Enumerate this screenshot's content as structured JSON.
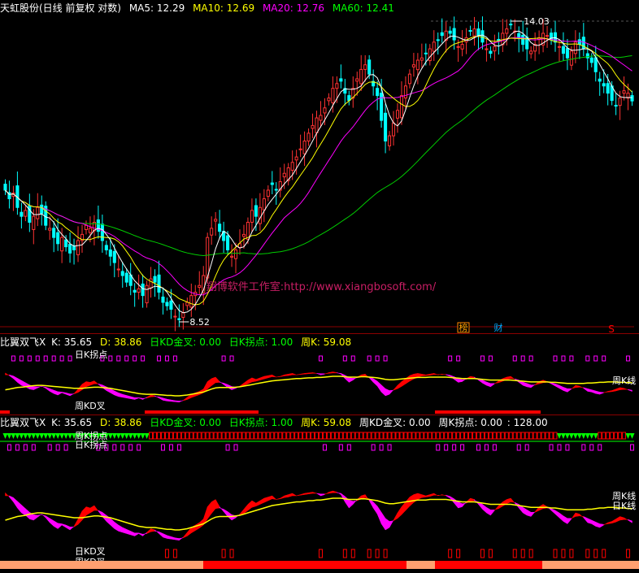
{
  "header_main": {
    "title": "天虹股份(日线 前复权 对数)",
    "ma5": "MA5: 12.29",
    "ma10": "MA10: 12.69",
    "ma20": "MA20: 12.76",
    "ma60": "MA60: 12.41"
  },
  "header_ind1": {
    "name": "比翼双飞X",
    "k": "K: 35.65",
    "d": "D: 38.86",
    "kd_cross": "日KD金叉: 0.00",
    "k_turn": "日K拐点: 1.00",
    "wk": "周K: 59.08"
  },
  "header_ind2": {
    "name": "比翼双飞X",
    "k": "K: 35.65",
    "d": "D: 38.86",
    "kd_cross": "日KD金叉: 0.00",
    "k_turn": "日K拐点: 1.00",
    "wk": "周K: 59.08",
    "wk_cross": "周KD金叉: 0.00",
    "wk_turn": "周K拐点: 0.00",
    "wk_extra": ": 128.00"
  },
  "price_labels": {
    "high": "14.03",
    "low": "8.52"
  },
  "watermark": "翔博软件工作室:http://www.xiangbosoft.com/",
  "badges": {
    "bang": "榜",
    "cai": "财",
    "s": "S"
  },
  "ind1_labels": {
    "top": "日K拐点",
    "bottom": "周KD叉",
    "right": "周K线"
  },
  "ind2_labels": {
    "top1": "周K拐点",
    "top2": "日K拐点",
    "bot1": "日KD叉",
    "bot2": "周KD叉",
    "right1": "周K线",
    "right2": "日K线"
  },
  "colors": {
    "up": "#ff3232",
    "down": "#00ffff",
    "ma5": "#ffffff",
    "ma10": "#ffff00",
    "ma20": "#ff00ff",
    "ma60": "#00cc00",
    "accent_red": "#ff0000",
    "magenta": "#ff00ff",
    "yellow": "#ffff00",
    "green_arrow": "#00ff00",
    "salmon": "#ffa070",
    "frame": "#8b0000"
  },
  "chart_data": {
    "type": "candlestick",
    "scale": "log",
    "price_range": [
      8.52,
      14.03
    ],
    "x": [
      0,
      1,
      2,
      3,
      4,
      5,
      6,
      7,
      8,
      9,
      10,
      11,
      12,
      13,
      14,
      15,
      16,
      17,
      18,
      19,
      20,
      21,
      22,
      23,
      24,
      25,
      26,
      27,
      28,
      29,
      30,
      31,
      32,
      33,
      34,
      35,
      36,
      37,
      38,
      39,
      40,
      41,
      42,
      43,
      44,
      45,
      46,
      47,
      48,
      49,
      50,
      51,
      52,
      53,
      54,
      55,
      56,
      57,
      58,
      59,
      60,
      61,
      62,
      63,
      64,
      65,
      66,
      67,
      68,
      69,
      70,
      71,
      72,
      73,
      74,
      75,
      76,
      77,
      78,
      79,
      80,
      81,
      82,
      83,
      84,
      85,
      86,
      87,
      88,
      89,
      90,
      91,
      92,
      93,
      94,
      95,
      96,
      97,
      98,
      99,
      100,
      101,
      102,
      103,
      104,
      105,
      106,
      107,
      108,
      109,
      110,
      111,
      112,
      113,
      114,
      115,
      116,
      117,
      118,
      119,
      120,
      121,
      122,
      123,
      124,
      125,
      126,
      127,
      128,
      129,
      130,
      131,
      132,
      133,
      134,
      135,
      136,
      137,
      138,
      139,
      140,
      141,
      142,
      143,
      144,
      145,
      146,
      147,
      148,
      149,
      150,
      151,
      152,
      153,
      154,
      155
    ],
    "close": [
      10.6,
      10.45,
      10.55,
      10.3,
      10.15,
      10.25,
      10.05,
      10.15,
      10.3,
      10.2,
      10.0,
      9.95,
      9.8,
      9.7,
      9.8,
      9.65,
      9.55,
      9.6,
      9.75,
      9.85,
      10.0,
      9.95,
      10.05,
      9.9,
      9.75,
      9.6,
      9.5,
      9.4,
      9.3,
      9.2,
      9.1,
      9.05,
      8.95,
      9.0,
      8.9,
      9.05,
      9.15,
      9.1,
      8.95,
      8.8,
      8.75,
      8.7,
      8.6,
      8.55,
      8.65,
      8.8,
      8.9,
      8.95,
      9.05,
      9.2,
      9.8,
      9.95,
      10.1,
      9.9,
      9.75,
      9.6,
      9.5,
      9.6,
      9.7,
      9.85,
      10.05,
      10.25,
      10.15,
      10.3,
      10.45,
      10.6,
      10.7,
      10.6,
      10.75,
      10.9,
      11.0,
      11.1,
      11.2,
      11.35,
      11.5,
      11.65,
      11.8,
      11.95,
      12.0,
      12.15,
      12.35,
      12.55,
      12.65,
      12.7,
      12.45,
      12.3,
      12.55,
      12.75,
      12.95,
      13.05,
      12.85,
      12.6,
      12.4,
      11.9,
      11.5,
      11.6,
      11.85,
      12.1,
      12.4,
      12.6,
      12.85,
      13.05,
      13.15,
      13.2,
      13.3,
      13.4,
      13.55,
      13.6,
      13.7,
      13.8,
      13.75,
      13.6,
      13.45,
      13.5,
      13.65,
      13.8,
      13.85,
      13.7,
      13.55,
      13.4,
      13.3,
      13.45,
      13.6,
      13.75,
      13.85,
      13.95,
      13.8,
      13.65,
      13.5,
      13.4,
      13.35,
      13.5,
      13.65,
      13.75,
      13.7,
      13.6,
      13.55,
      13.45,
      13.3,
      13.2,
      13.35,
      13.55,
      13.5,
      13.4,
      13.2,
      13.1,
      12.9,
      12.7,
      12.6,
      12.45,
      12.3,
      12.2,
      12.35,
      12.5,
      12.45,
      12.29
    ],
    "k_daily": [
      85,
      78,
      70,
      60,
      52,
      48,
      42,
      40,
      45,
      50,
      44,
      36,
      30,
      26,
      32,
      28,
      24,
      30,
      42,
      55,
      62,
      60,
      64,
      55,
      46,
      38,
      32,
      26,
      22,
      20,
      18,
      16,
      14,
      18,
      14,
      20,
      26,
      24,
      18,
      12,
      10,
      9,
      8,
      7,
      12,
      20,
      28,
      32,
      36,
      42,
      62,
      70,
      74,
      62,
      54,
      46,
      40,
      44,
      50,
      58,
      66,
      72,
      68,
      72,
      76,
      78,
      80,
      74,
      76,
      80,
      82,
      84,
      80,
      82,
      84,
      85,
      86,
      84,
      80,
      82,
      86,
      88,
      86,
      82,
      70,
      60,
      66,
      74,
      80,
      82,
      72,
      60,
      50,
      34,
      24,
      28,
      40,
      52,
      62,
      70,
      78,
      82,
      84,
      82,
      80,
      82,
      84,
      80,
      82,
      80,
      76,
      68,
      60,
      62,
      70,
      76,
      74,
      66,
      58,
      52,
      48,
      56,
      64,
      70,
      74,
      76,
      68,
      60,
      52,
      48,
      46,
      54,
      62,
      66,
      62,
      56,
      50,
      44,
      38,
      34,
      42,
      52,
      50,
      44,
      36,
      34,
      30,
      28,
      32,
      36,
      38,
      42,
      46,
      44,
      40,
      35.65
    ],
    "d_daily": [
      80,
      80,
      77,
      71,
      65,
      59,
      53,
      49,
      48,
      49,
      47,
      43,
      39,
      35,
      34,
      32,
      29,
      29,
      33,
      40,
      48,
      52,
      56,
      56,
      53,
      48,
      43,
      37,
      32,
      28,
      25,
      22,
      19,
      19,
      17,
      18,
      21,
      22,
      21,
      18,
      15,
      13,
      11,
      10,
      11,
      14,
      19,
      23,
      27,
      32,
      42,
      51,
      59,
      60,
      58,
      54,
      49,
      47,
      48,
      51,
      56,
      61,
      63,
      66,
      69,
      72,
      75,
      74,
      75,
      77,
      78,
      80,
      80,
      81,
      82,
      83,
      84,
      84,
      83,
      83,
      84,
      85,
      85,
      84,
      79,
      73,
      71,
      72,
      75,
      77,
      75,
      70,
      63,
      53,
      43,
      38,
      39,
      43,
      49,
      56,
      63,
      69,
      74,
      77,
      78,
      79,
      81,
      81,
      81,
      81,
      79,
      75,
      70,
      67,
      68,
      71,
      72,
      70,
      66,
      61,
      57,
      57,
      59,
      63,
      67,
      70,
      69,
      66,
      61,
      57,
      53,
      53,
      56,
      59,
      60,
      59,
      56,
      52,
      47,
      43,
      43,
      46,
      47,
      46,
      43,
      40,
      37,
      34,
      33,
      34,
      35,
      37,
      40,
      41,
      41,
      38.86
    ],
    "k_weekly": [
      40,
      42,
      44,
      46,
      47,
      48,
      50,
      51,
      52,
      52,
      51,
      50,
      49,
      48,
      47,
      46,
      45,
      44,
      44,
      44,
      45,
      46,
      47,
      47,
      46,
      45,
      44,
      42,
      40,
      38,
      36,
      34,
      32,
      30,
      29,
      28,
      28,
      28,
      27,
      26,
      25,
      25,
      24,
      24,
      25,
      26,
      28,
      30,
      32,
      34,
      38,
      42,
      45,
      46,
      46,
      46,
      46,
      47,
      48,
      50,
      52,
      54,
      56,
      58,
      60,
      62,
      64,
      65,
      66,
      67,
      68,
      69,
      70,
      70,
      71,
      72,
      72,
      73,
      73,
      74,
      75,
      76,
      76,
      76,
      75,
      74,
      74,
      74,
      75,
      75,
      74,
      73,
      72,
      70,
      68,
      67,
      67,
      68,
      69,
      70,
      71,
      72,
      73,
      73,
      73,
      74,
      74,
      74,
      74,
      74,
      73,
      72,
      71,
      70,
      70,
      70,
      70,
      69,
      68,
      67,
      66,
      66,
      66,
      66,
      66,
      66,
      65,
      64,
      63,
      62,
      61,
      61,
      61,
      61,
      61,
      60,
      60,
      59,
      58,
      57,
      57,
      57,
      57,
      57,
      58,
      58,
      59,
      60,
      60,
      61,
      61,
      61,
      60,
      60,
      59,
      59.08
    ],
    "ma_periods": [
      5,
      10,
      20,
      60
    ],
    "annotations": [
      "14.03",
      "8.52"
    ]
  }
}
